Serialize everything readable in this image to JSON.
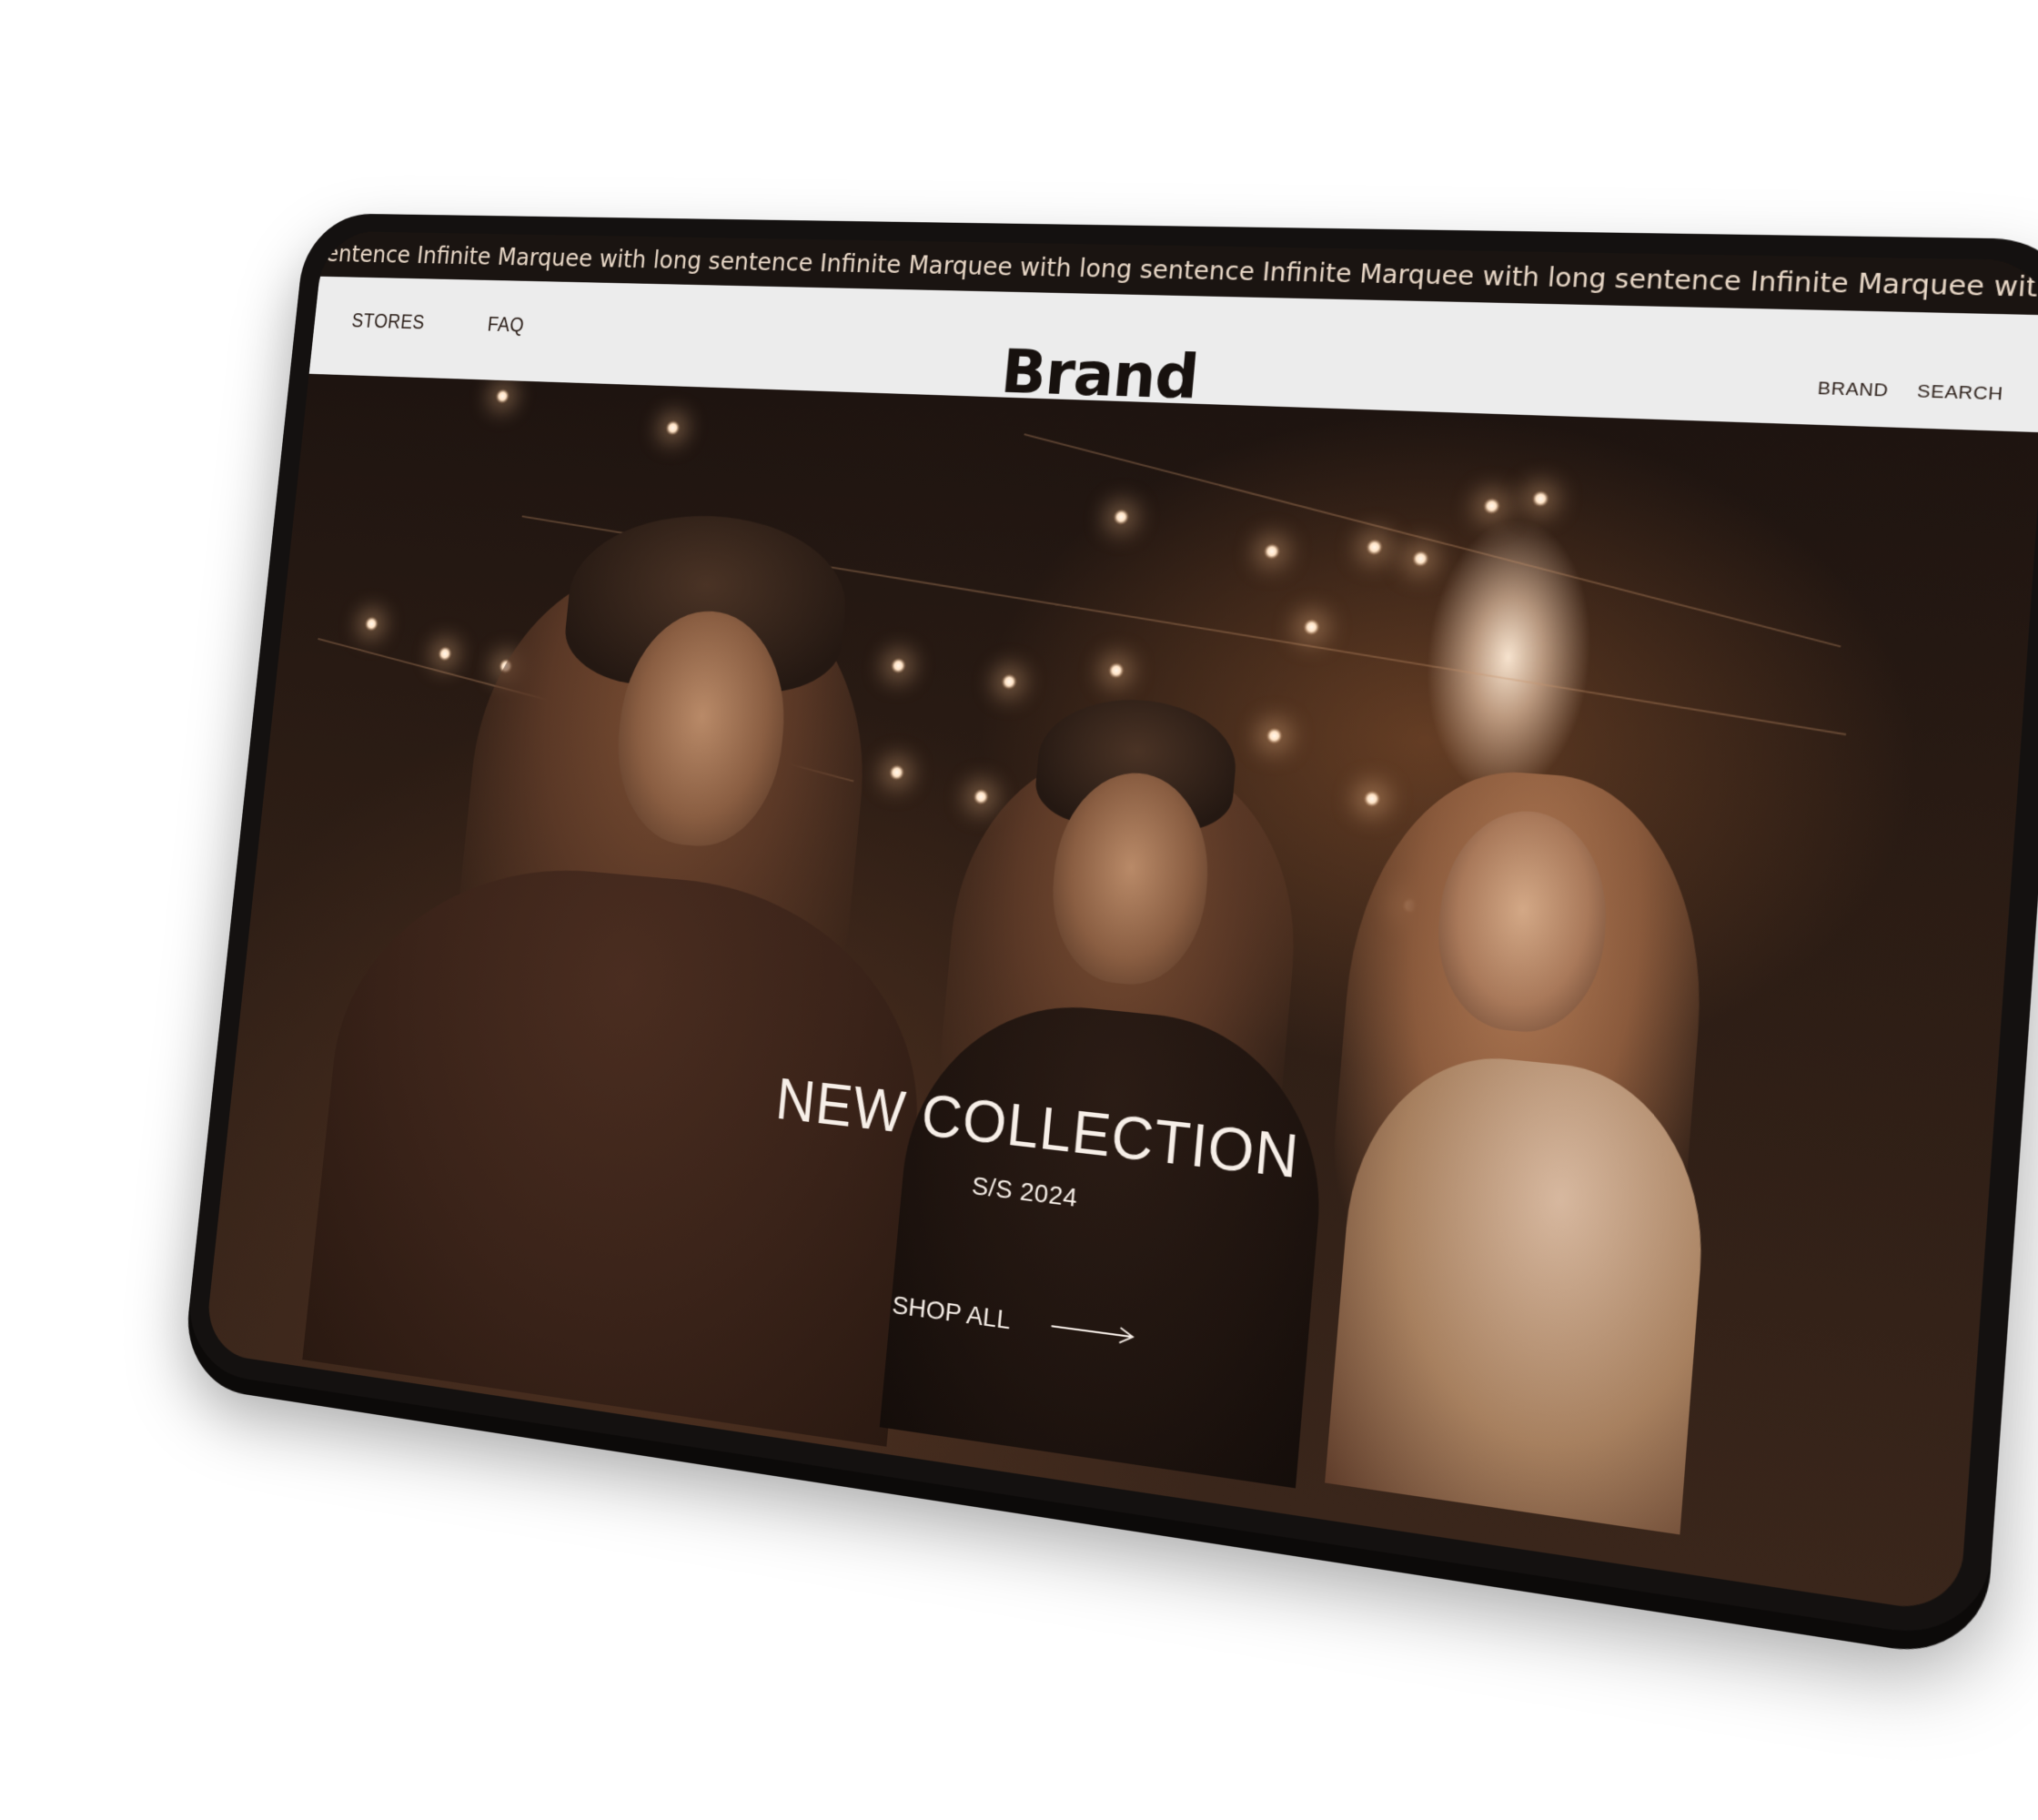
{
  "marquee": {
    "text": "g sentence Infinite Marquee with long sentence Infinite Marquee with long sentence Infinite Marquee with long sentence Infinite Marquee with long sentence Infinite Marquee"
  },
  "nav": {
    "stores_label": "STORES",
    "faq_label": "FAQ",
    "logo": "Brand",
    "brand_label": "BRAND",
    "search_label": "SEARCH"
  },
  "hero": {
    "title": "NEW COLLECTION",
    "subtitle": "S/S 2024",
    "cta_label": "SHOP ALL",
    "cta_icon": "arrow-right-icon"
  },
  "colors": {
    "navbar_bg": "#ececec",
    "marquee_bg": "#1a1411",
    "hero_tone": "#3a261b",
    "text_light": "#f7efe8"
  }
}
